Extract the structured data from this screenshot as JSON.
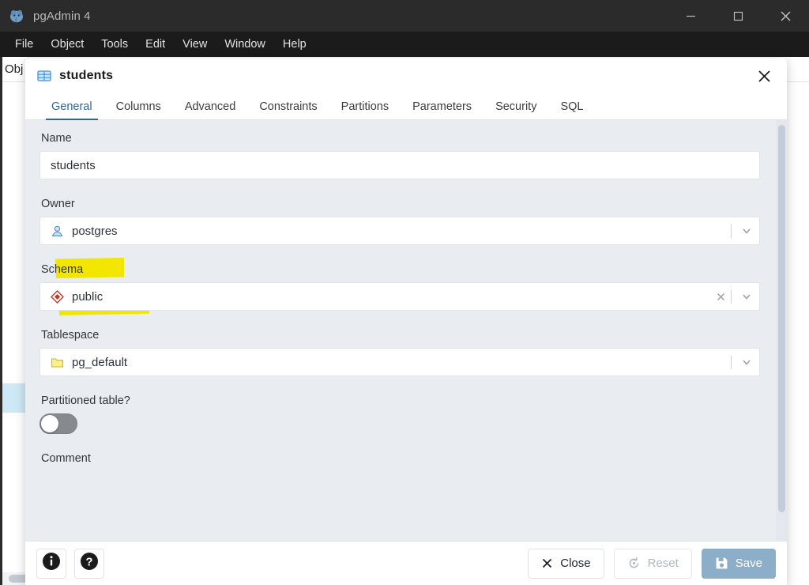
{
  "window": {
    "title": "pgAdmin 4",
    "logo_icon": "pgadmin-elephant-logo",
    "minimize_icon": "minimize-icon",
    "maximize_icon": "maximize-icon",
    "close_icon": "close-icon"
  },
  "menubar": {
    "items": [
      {
        "label": "File"
      },
      {
        "label": "Object"
      },
      {
        "label": "Tools"
      },
      {
        "label": "Edit"
      },
      {
        "label": "View"
      },
      {
        "label": "Window"
      },
      {
        "label": "Help"
      }
    ]
  },
  "browser": {
    "panel_title": "Obj",
    "overflow_menu_icon": "vertical-dots-icon"
  },
  "dialog": {
    "title": "students",
    "title_icon": "table-icon",
    "close_icon": "close-icon",
    "tabs": [
      {
        "label": "General",
        "active": true
      },
      {
        "label": "Columns",
        "active": false
      },
      {
        "label": "Advanced",
        "active": false
      },
      {
        "label": "Constraints",
        "active": false
      },
      {
        "label": "Partitions",
        "active": false
      },
      {
        "label": "Parameters",
        "active": false
      },
      {
        "label": "Security",
        "active": false
      },
      {
        "label": "SQL",
        "active": false
      }
    ],
    "fields": {
      "name": {
        "label": "Name",
        "value": "students",
        "placeholder": "",
        "highlighted": true,
        "highlight_color": "#f2e600"
      },
      "owner": {
        "label": "Owner",
        "value": "postgres",
        "icon": "user-icon",
        "caret_icon": "chevron-down-icon"
      },
      "schema": {
        "label": "Schema",
        "value": "public",
        "icon": "schema-diamond-icon",
        "clear_icon": "clear-x-icon",
        "caret_icon": "chevron-down-icon"
      },
      "tablespace": {
        "label": "Tablespace",
        "value": "pg_default",
        "icon": "folder-icon",
        "caret_icon": "chevron-down-icon"
      },
      "partitioned": {
        "label": "Partitioned table?",
        "state": "off"
      },
      "comment": {
        "label": "Comment",
        "value": ""
      }
    },
    "footer": {
      "info_icon": "info-icon",
      "help_icon": "help-icon",
      "close_button": {
        "label": "Close",
        "icon": "close-x-icon",
        "disabled": false
      },
      "reset_button": {
        "label": "Reset",
        "icon": "reset-icon",
        "disabled": true
      },
      "save_button": {
        "label": "Save",
        "icon": "save-disk-icon",
        "disabled": false,
        "color": "#8caec8"
      }
    }
  }
}
